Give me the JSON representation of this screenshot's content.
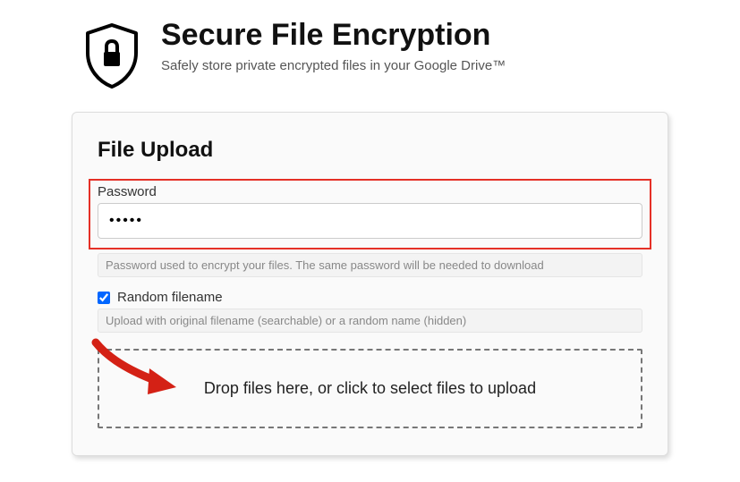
{
  "header": {
    "title": "Secure File Encryption",
    "subtitle": "Safely store private encrypted files in your Google Drive™"
  },
  "card": {
    "title": "File Upload",
    "password": {
      "label": "Password",
      "value": "•••••",
      "helper": "Password used to encrypt your files. The same password will be needed to download"
    },
    "random_filename": {
      "label": "Random filename",
      "checked": true,
      "helper": "Upload with original filename (searchable) or a random name (hidden)"
    },
    "dropzone": {
      "text": "Drop files here, or click to select files to upload"
    }
  }
}
